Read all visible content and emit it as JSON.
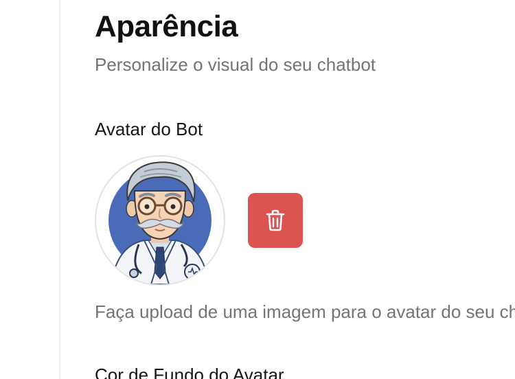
{
  "page": {
    "title": "Aparência",
    "subtitle": "Personalize o visual do seu chatbot"
  },
  "avatar_section": {
    "title": "Avatar do Bot",
    "help_text": "Faça upload de uma imagem para o avatar do seu chatbot",
    "avatar_image": "doctor-cartoon-avatar",
    "delete_icon": "trash-icon"
  },
  "background_section": {
    "title": "Cor de Fundo do Avatar"
  },
  "colors": {
    "delete_button": "#dc5452",
    "avatar_background": "#4a6cb8"
  }
}
